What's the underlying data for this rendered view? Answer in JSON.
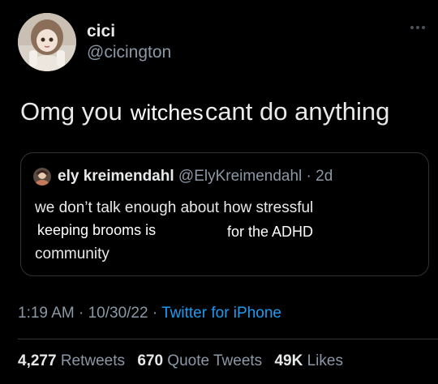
{
  "tweet": {
    "display_name": "cici",
    "handle": "@cicington",
    "text_before": "Omg you",
    "text_overlay": "witches",
    "text_after": "cant do anything",
    "more_icon": "more-dots-icon"
  },
  "quote": {
    "author_name": "ely kreimendahl",
    "author_handle": "@ElyKreimendahl",
    "separator": "·",
    "age": "2d",
    "line1": "we don’t talk enough about how stressful",
    "line2_overlay": "keeping brooms is",
    "line2_rest": "for the ADHD",
    "line3": "community"
  },
  "meta": {
    "time": "1:19 AM",
    "separator1": "·",
    "date": "10/30/22",
    "separator2": "·",
    "source": "Twitter for iPhone"
  },
  "stats": {
    "retweets_count": "4,277",
    "retweets_label": "Retweets",
    "quotes_count": "670",
    "quotes_label": "Quote Tweets",
    "likes_count": "49K",
    "likes_label": "Likes"
  },
  "colors": {
    "background": "#000000",
    "text_primary": "#e7e9ea",
    "text_secondary": "#8b98a5",
    "link": "#1d9bf0",
    "border": "#2f3336"
  }
}
